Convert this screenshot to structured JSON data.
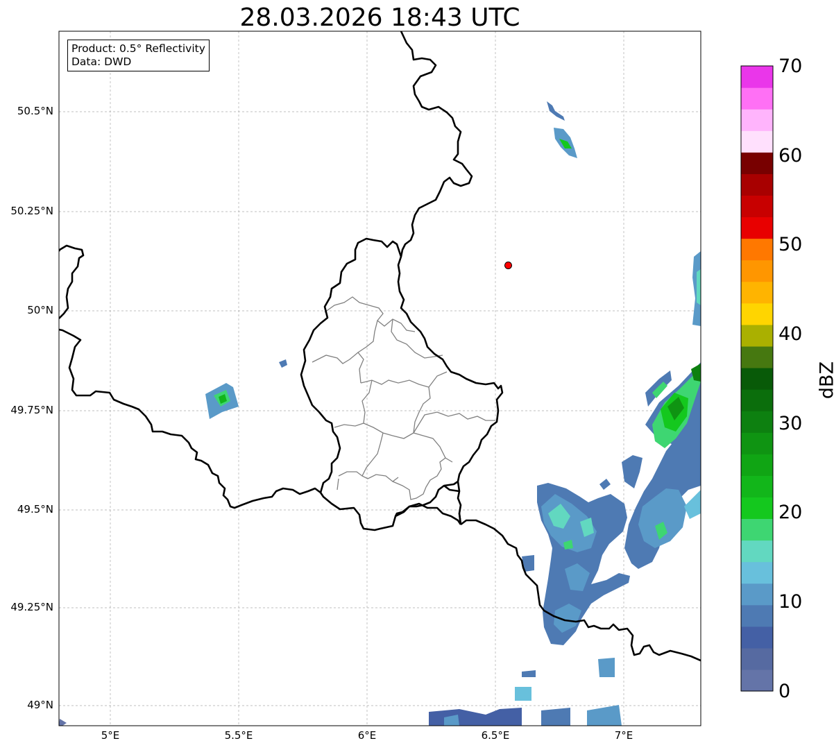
{
  "title": "28.03.2026 18:43 UTC",
  "info": {
    "product": "Product: 0.5° Reflectivity",
    "source": "Data: DWD"
  },
  "map": {
    "lat_ticks": [
      "50.5°N",
      "50.25°N",
      "50°N",
      "49.75°N",
      "49.5°N",
      "49.25°N",
      "49°N"
    ],
    "lon_ticks": [
      "5°E",
      "5.5°E",
      "6°E",
      "6.5°E",
      "7°E"
    ],
    "lon_range": [
      4.8,
      7.3
    ],
    "lat_range": [
      48.95,
      50.7
    ],
    "grid": true,
    "marker": {
      "lon": 6.55,
      "lat": 50.11,
      "color": "#ff0000"
    }
  },
  "colorbar": {
    "label": "dBZ",
    "min": 0,
    "max": 70,
    "tick_labels": [
      "70",
      "60",
      "50",
      "40",
      "30",
      "20",
      "10",
      "0"
    ],
    "colors_bottom_to_top": [
      "#6474a8",
      "#566aa1",
      "#4460a5",
      "#4e7ab3",
      "#5a9ac8",
      "#68c0dc",
      "#62d8c0",
      "#3ed672",
      "#14c81e",
      "#12b61a",
      "#10a514",
      "#0f9412",
      "#0d8010",
      "#0b6e0c",
      "#085a08",
      "#467810",
      "#aab000",
      "#ffd500",
      "#ffb400",
      "#ff9600",
      "#ff7800",
      "#e80000",
      "#c80000",
      "#a80000",
      "#780000",
      "#ffe0fd",
      "#ffb4fc",
      "#ff70f5",
      "#ea36ea"
    ]
  }
}
